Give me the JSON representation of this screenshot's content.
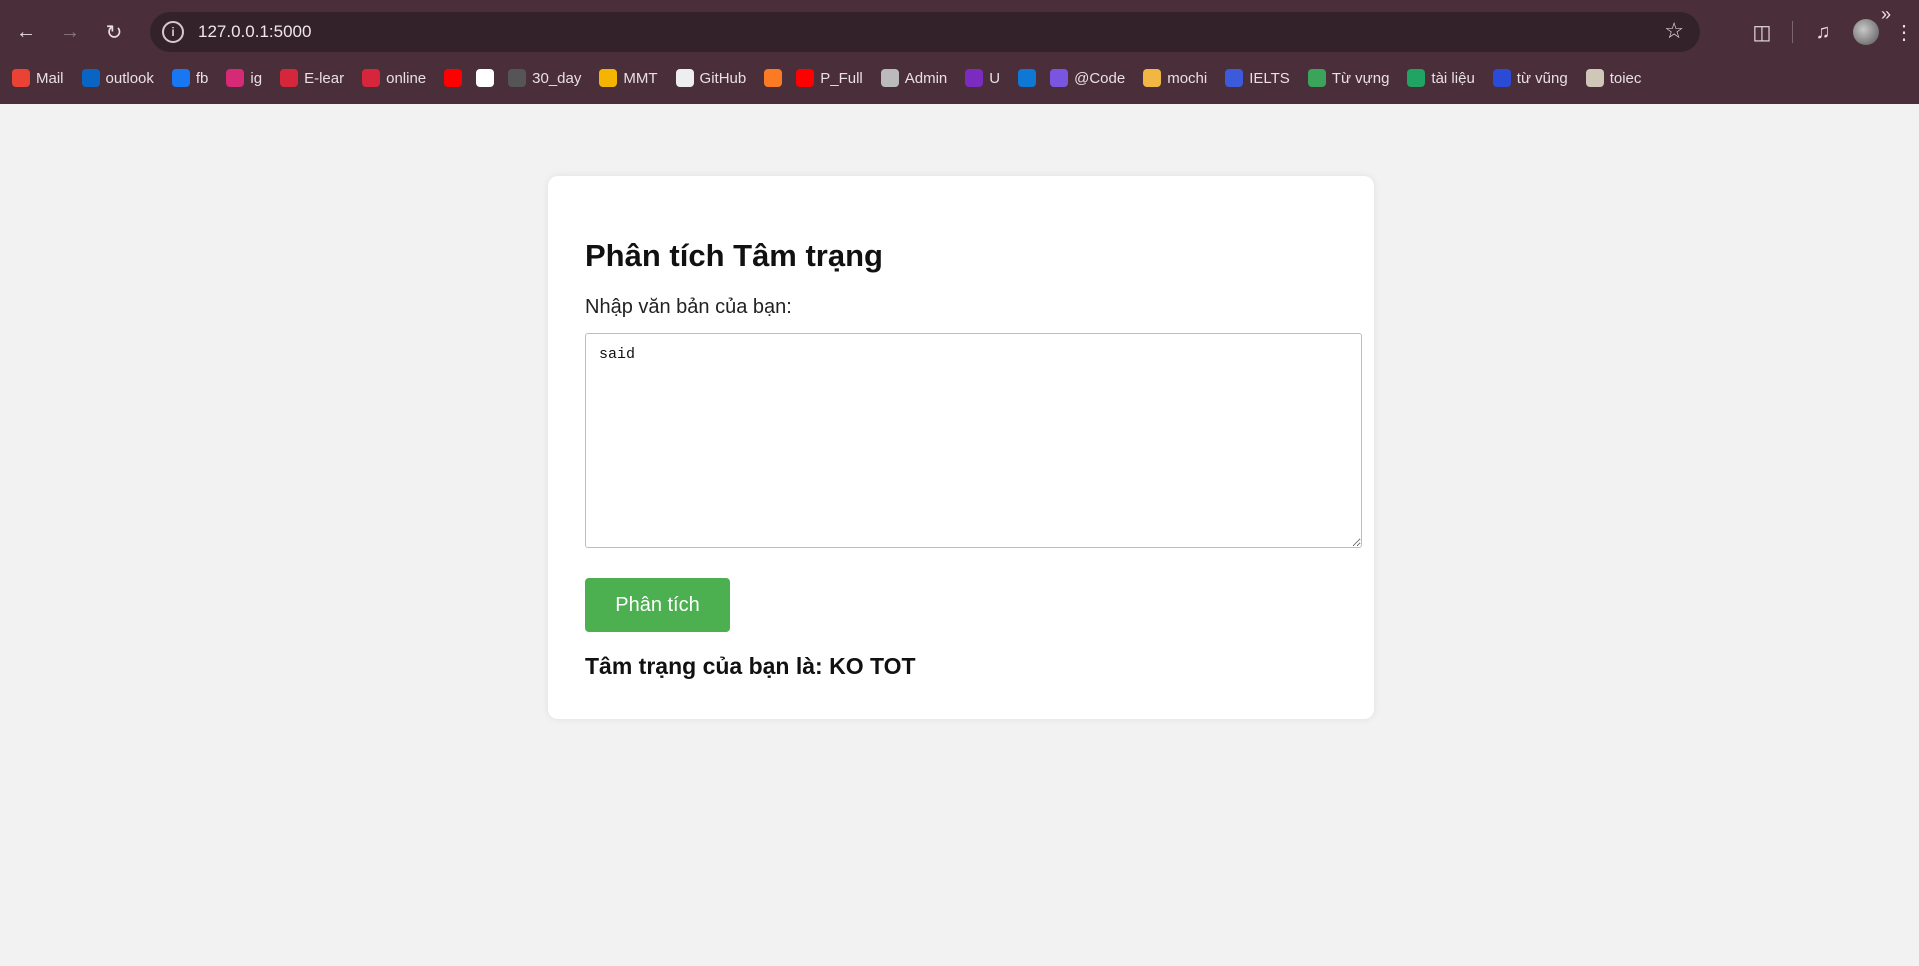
{
  "browser": {
    "url": "127.0.0.1:5000",
    "bookmarks": [
      {
        "label": "Mail",
        "icon": "gmail-icon",
        "color": "#ea4335"
      },
      {
        "label": "outlook",
        "icon": "outlook-icon",
        "color": "#0a64c4"
      },
      {
        "label": "fb",
        "icon": "facebook-icon",
        "color": "#1877f2"
      },
      {
        "label": "ig",
        "icon": "instagram-icon",
        "color": "#d62976"
      },
      {
        "label": "E-lear",
        "icon": "vivaldi-icon",
        "color": "#d6263b"
      },
      {
        "label": "online",
        "icon": "vivaldi-icon",
        "color": "#d6263b"
      },
      {
        "label": "",
        "icon": "youtube-icon",
        "color": "#ff0000"
      },
      {
        "label": "",
        "icon": "openai-icon",
        "color": "#ffffff"
      },
      {
        "label": "30_day",
        "icon": "github-icon",
        "color": "#555555"
      },
      {
        "label": "MMT",
        "icon": "classroom-icon",
        "color": "#f4b400"
      },
      {
        "label": "GitHub",
        "icon": "github-icon",
        "color": "#eeeeee"
      },
      {
        "label": "",
        "icon": "xampp-icon",
        "color": "#fb7a24"
      },
      {
        "label": "P_Full",
        "icon": "youtube-icon",
        "color": "#ff0000"
      },
      {
        "label": "Admin",
        "icon": "globe-icon",
        "color": "#bbbbbb"
      },
      {
        "label": "U",
        "icon": "u-icon",
        "color": "#7b2cbf"
      },
      {
        "label": "",
        "icon": "onedrive-icon",
        "color": "#0f78d4"
      },
      {
        "label": "@Code",
        "icon": "code-icon",
        "color": "#7a56e0"
      },
      {
        "label": "mochi",
        "icon": "mochi-icon",
        "color": "#f2b742"
      },
      {
        "label": "IELTS",
        "icon": "ielts-icon",
        "color": "#3b5bdb"
      },
      {
        "label": "Từ vựng",
        "icon": "globe-icon",
        "color": "#3aa45a"
      },
      {
        "label": "tài liệu",
        "icon": "drive-icon",
        "color": "#1fa463"
      },
      {
        "label": "từ vũng",
        "icon": "world-icon",
        "color": "#2a4bd6"
      },
      {
        "label": "toiec",
        "icon": "t-icon",
        "color": "#cfc8b8"
      }
    ]
  },
  "page": {
    "title": "Phân tích Tâm trạng",
    "input_label": "Nhập văn bản của bạn:",
    "input_value": "said",
    "button_label": "Phân tích",
    "result_text": "Tâm trạng của bạn là: KO TOT"
  },
  "colors": {
    "chrome_bg": "#4a2f3a",
    "page_bg": "#f2f2f2",
    "button_bg": "#4caf50"
  }
}
